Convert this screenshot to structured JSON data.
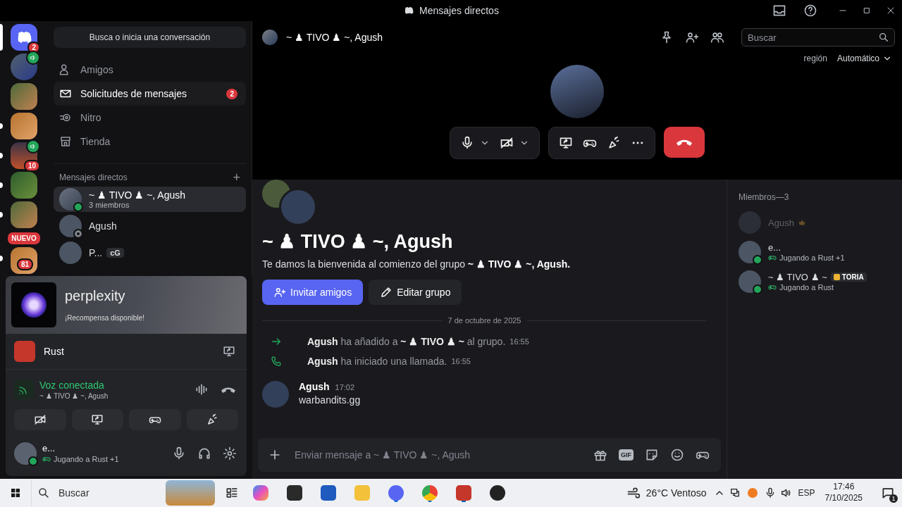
{
  "window": {
    "title": "Mensajes directos"
  },
  "servers": [
    {
      "kind": "home",
      "selected": true,
      "unread": false,
      "voice": false,
      "badge": "2"
    },
    {
      "kind": "avatar",
      "selected": false,
      "unread": false,
      "voice": true
    },
    {
      "kind": "picture",
      "selected": false,
      "unread": false,
      "voice": false
    },
    {
      "kind": "picture",
      "selected": false,
      "unread": true,
      "voice": false
    },
    {
      "kind": "picture",
      "selected": false,
      "unread": true,
      "voice": true,
      "badge": "10"
    },
    {
      "kind": "picture",
      "selected": false,
      "unread": true,
      "voice": false
    },
    {
      "kind": "picture",
      "selected": false,
      "unread": true,
      "voice": false
    },
    {
      "kind": "picture",
      "selected": false,
      "unread": true,
      "voice": false,
      "label": "NUEVO",
      "badge": "81"
    }
  ],
  "dm_sidebar": {
    "search": "Busca o inicia una conversación",
    "nav": [
      {
        "kind": "friends",
        "label": "Amigos",
        "hovered": false
      },
      {
        "kind": "requests",
        "label": "Solicitudes de mensajes",
        "hovered": true,
        "badge": "2"
      },
      {
        "kind": "nitro",
        "label": "Nitro",
        "hovered": false
      },
      {
        "kind": "shop",
        "label": "Tienda",
        "hovered": false
      }
    ],
    "section": "Mensajes directos",
    "add": "+",
    "dms": [
      {
        "kind": "group",
        "name": "~ ♟ TIVO ♟ ~, Agush",
        "sub": "3 miembros",
        "selected": true,
        "online": true
      },
      {
        "kind": "user",
        "name": "Agush",
        "selected": false,
        "online": false
      },
      {
        "kind": "user",
        "name": "P...",
        "tag": "cG",
        "selected": false
      }
    ]
  },
  "user_panel": {
    "promo": {
      "title": "perplexity",
      "sub": "¡Recompensa disponible!"
    },
    "game": "Rust",
    "voice": {
      "status": "Voz conectada",
      "channel": "~ ♟ TIVO ♟ ~, Agush"
    },
    "user": {
      "name": "e...",
      "activity": "Jugando a Rust +1",
      "online": true
    }
  },
  "header": {
    "title": "~ ♟ TIVO ♟ ~, Agush",
    "search": {
      "placeholder": "Buscar"
    }
  },
  "call": {
    "region_label": "región",
    "region_value": "Automático",
    "mic_muted": false,
    "camera_on": false
  },
  "chat": {
    "title": "~ ♟ TIVO ♟ ~, Agush",
    "welcome": "Te damos la bienvenida al comienzo del grupo **~ ♟ TIVO ♟ ~, Agush.**",
    "buttons": [
      "Invitar amigos",
      "Editar grupo"
    ],
    "date": "7 de octubre de 2025",
    "events": [
      {
        "kind": "join",
        "text": "**Agush** ha añadido a **~ ♟ TIVO ♟ ~** al grupo.",
        "time": "16:55"
      },
      {
        "kind": "call",
        "text": "**Agush** ha iniciado una llamada.",
        "time": "16:55"
      }
    ],
    "messages": [
      {
        "author": "Agush",
        "time": "17:02",
        "text": "warbandits.gg"
      }
    ],
    "input": {
      "placeholder": "Enviar mensaje a ~ ♟ TIVO ♟ ~, Agush"
    },
    "gif_label": "GIF"
  },
  "members": {
    "title": "Miembros—3",
    "list": [
      {
        "name": "Agush",
        "online": false,
        "owner": true
      },
      {
        "name": "e...",
        "online": true,
        "owner": false,
        "activity": "Jugando a Rust +1"
      },
      {
        "name": "~ ♟ TIVO ♟ ~",
        "online": true,
        "owner": false,
        "tag": "TORIA",
        "activity": "Jugando a Rust"
      }
    ]
  },
  "taskbar": {
    "search": {
      "placeholder": "Buscar"
    },
    "weather": "26°C Ventoso",
    "language": "ESP",
    "time": "17:46",
    "date": "7/10/2025",
    "notifications": "1"
  }
}
